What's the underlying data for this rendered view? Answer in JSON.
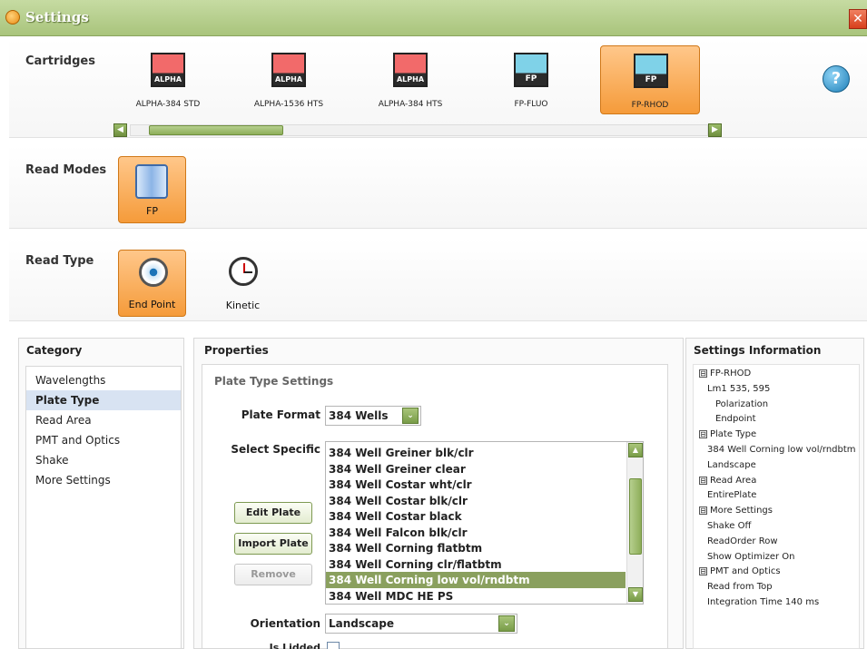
{
  "window": {
    "title": "Settings",
    "close_glyph": "✕"
  },
  "cartridges": {
    "label": "Cartridges",
    "items": [
      {
        "label": "ALPHA-384 STD",
        "kind": "alpha",
        "selected": false
      },
      {
        "label": "ALPHA-1536 HTS",
        "kind": "alpha",
        "selected": false
      },
      {
        "label": "ALPHA-384 HTS",
        "kind": "alpha",
        "selected": false
      },
      {
        "label": "FP-FLUO",
        "kind": "fp",
        "selected": false
      },
      {
        "label": "FP-RHOD",
        "kind": "fp",
        "selected": true
      }
    ],
    "scroll_left": "◀",
    "scroll_right": "▶"
  },
  "help": {
    "glyph": "?"
  },
  "read_modes": {
    "label": "Read Modes",
    "items": [
      {
        "label": "FP",
        "selected": true
      }
    ]
  },
  "read_type": {
    "label": "Read Type",
    "items": [
      {
        "label": "End Point",
        "selected": true
      },
      {
        "label": "Kinetic",
        "selected": false
      }
    ]
  },
  "category": {
    "title": "Category",
    "items": [
      "Wavelengths",
      "Plate Type",
      "Read Area",
      "PMT and Optics",
      "Shake",
      "More Settings"
    ],
    "active": "Plate Type"
  },
  "properties": {
    "title": "Properties",
    "subtitle": "Plate Type Settings",
    "plate_format_label": "Plate Format",
    "plate_format_value": "384 Wells",
    "select_specific_label": "Select Specific",
    "plates": [
      "384 Well Greiner blk/clr",
      "384 Well Greiner clear",
      "384 Well Costar wht/clr",
      "384 Well Costar blk/clr",
      "384 Well Costar black",
      "384 Well Falcon blk/clr",
      "384 Well Corning flatbtm",
      "384 Well Corning clr/flatbtm",
      "384 Well Corning low vol/rndbtm",
      "384 Well MDC HE PS"
    ],
    "selected_plate": "384 Well Corning low vol/rndbtm",
    "buttons": {
      "edit": "Edit Plate",
      "import": "Import Plate",
      "remove": "Remove"
    },
    "orientation_label": "Orientation",
    "orientation_value": "Landscape",
    "is_lidded_label": "Is Lidded",
    "dropdown_glyph": "⌄",
    "scroll_up": "▲",
    "scroll_down": "▼"
  },
  "settings_info": {
    "title": "Settings Information",
    "lines": [
      {
        "text": "FP-RHOD",
        "indent": 0,
        "toggle": "⊟"
      },
      {
        "text": "Lm1    535, 595",
        "indent": 1,
        "toggle": ""
      },
      {
        "text": "Polarization",
        "indent": 2,
        "toggle": ""
      },
      {
        "text": "Endpoint",
        "indent": 2,
        "toggle": ""
      },
      {
        "text": "Plate Type",
        "indent": 0,
        "toggle": "⊟"
      },
      {
        "text": "384 Well Corning low vol/rndbtm",
        "indent": 1,
        "toggle": ""
      },
      {
        "text": "Landscape",
        "indent": 1,
        "toggle": ""
      },
      {
        "text": "Read Area",
        "indent": 0,
        "toggle": "⊟"
      },
      {
        "text": "EntirePlate",
        "indent": 1,
        "toggle": ""
      },
      {
        "text": "More Settings",
        "indent": 0,
        "toggle": "⊟"
      },
      {
        "text": "Shake  Off",
        "indent": 1,
        "toggle": ""
      },
      {
        "text": "ReadOrder  Row",
        "indent": 1,
        "toggle": ""
      },
      {
        "text": "Show Optimizer  On",
        "indent": 1,
        "toggle": ""
      },
      {
        "text": "PMT and Optics",
        "indent": 0,
        "toggle": "⊟"
      },
      {
        "text": "Read from  Top",
        "indent": 1,
        "toggle": ""
      },
      {
        "text": "Integration Time  140 ms",
        "indent": 1,
        "toggle": ""
      }
    ]
  }
}
